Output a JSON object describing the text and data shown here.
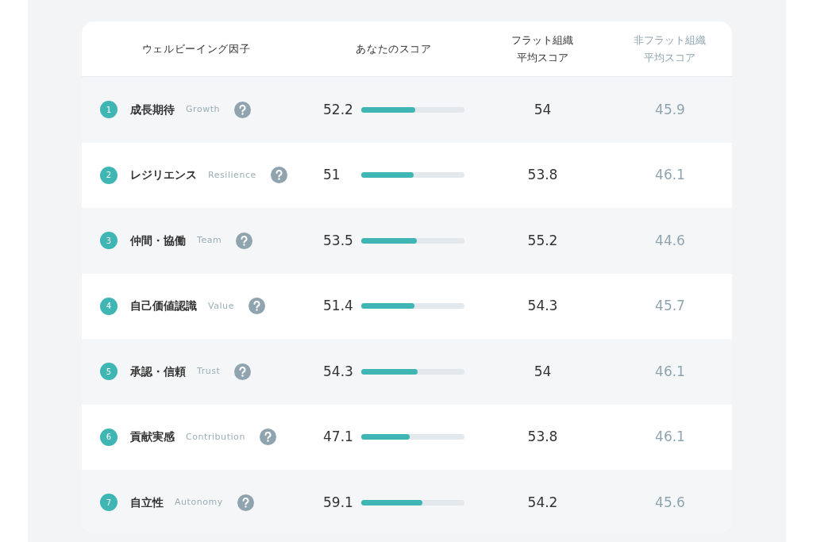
{
  "table": {
    "columns": [
      {
        "label": "ウェルビーイング因子"
      },
      {
        "label": "あなたのスコア"
      },
      {
        "label": "フラット組織平均スコア"
      },
      {
        "label": "非フラット組織平均スコア"
      }
    ],
    "rows": [
      {
        "number": "1",
        "name": "成長期待",
        "english": "Growth",
        "score": "52.2",
        "level": 0.522,
        "flat": "54",
        "non_flat": "45.9"
      },
      {
        "number": "2",
        "name": "レジリエンス",
        "english": "Resilience",
        "score": "51",
        "level": 0.51,
        "flat": "53.8",
        "non_flat": "46.1"
      },
      {
        "number": "3",
        "name": "仲間・協働",
        "english": "Team",
        "score": "53.5",
        "level": 0.535,
        "flat": "55.2",
        "non_flat": "44.6"
      },
      {
        "number": "4",
        "name": "自己価値認識",
        "english": "Value",
        "score": "51.4",
        "level": 0.514,
        "flat": "54.3",
        "non_flat": "45.7"
      },
      {
        "number": "5",
        "name": "承認・信頼",
        "english": "Trust",
        "score": "54.3",
        "level": 0.543,
        "flat": "54",
        "non_flat": "46.1"
      },
      {
        "number": "6",
        "name": "貢献実感",
        "english": "Contribution",
        "score": "47.1",
        "level": 0.471,
        "flat": "53.8",
        "non_flat": "46.1"
      },
      {
        "number": "7",
        "name": "自立性",
        "english": "Autonomy",
        "score": "59.1",
        "level": 0.591,
        "flat": "54.2",
        "non_flat": "45.6"
      }
    ]
  }
}
